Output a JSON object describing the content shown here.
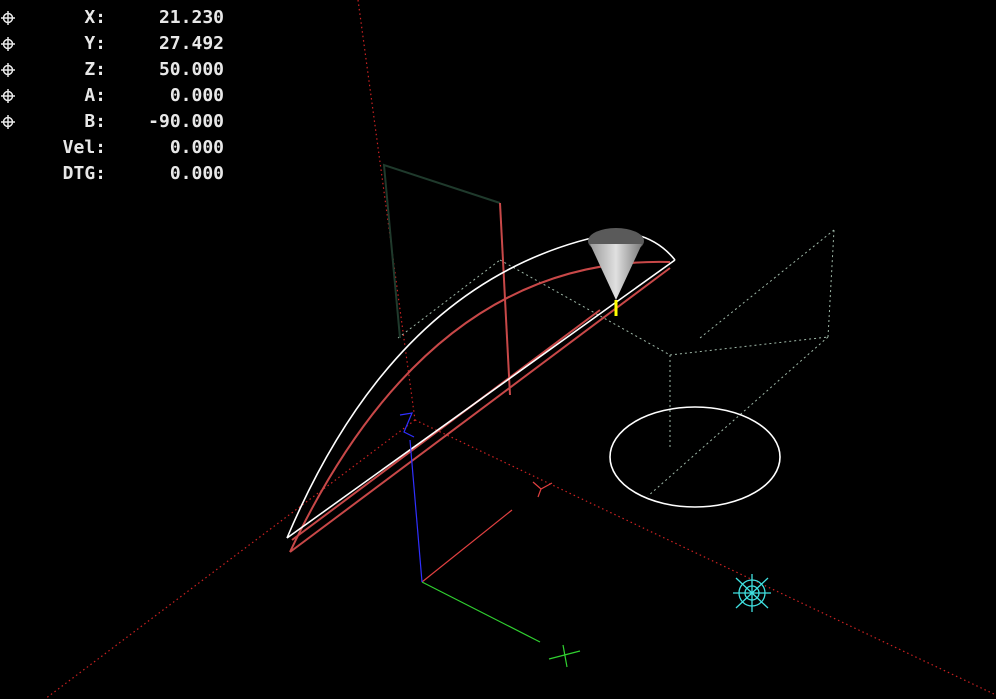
{
  "dro": {
    "rows": [
      {
        "label": "X:",
        "value": "21.230",
        "homed": true
      },
      {
        "label": "Y:",
        "value": "27.492",
        "homed": true
      },
      {
        "label": "Z:",
        "value": "50.000",
        "homed": true
      },
      {
        "label": "A:",
        "value": "0.000",
        "homed": true
      },
      {
        "label": "B:",
        "value": "-90.000",
        "homed": true
      },
      {
        "label": "Vel:",
        "value": "0.000",
        "homed": false
      },
      {
        "label": "DTG:",
        "value": "0.000",
        "homed": false
      }
    ]
  },
  "icons": {
    "homed": "homed-target-icon",
    "tool": "tool-cone-icon",
    "origin": "origin-marker-icon",
    "limit": "limit-marker-icon"
  },
  "colors": {
    "background": "#000000",
    "text": "#e8e8e8",
    "limits": "#cc2222",
    "toolpath_feed": "#c84848",
    "toolpath_preview": "#ffffff",
    "traverse": "#9fb8a8",
    "axis_x": "#e04040",
    "axis_y": "#30d030",
    "axis_z": "#3030ff",
    "tool": "#c0c0c0",
    "tool_tip": "#ffff00",
    "origin_marker": "#40e0e0"
  }
}
